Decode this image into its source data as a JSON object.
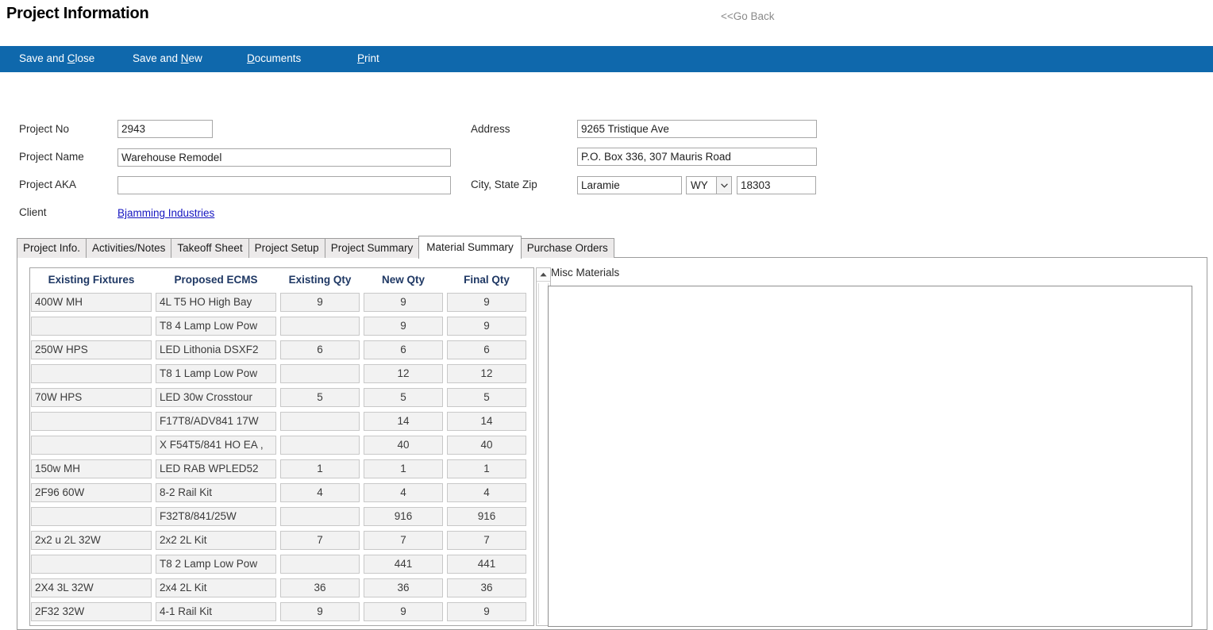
{
  "header": {
    "title": "Project Information",
    "go_back": "<<Go Back"
  },
  "command_bar": {
    "accent_color": "#0f68ac",
    "items": [
      {
        "label": "Save and Close",
        "accel_index": 9
      },
      {
        "label": "Save and New",
        "accel_index": 9
      },
      {
        "label": "Documents",
        "accel_index": 0
      },
      {
        "label": "Print",
        "accel_index": 0
      }
    ]
  },
  "form": {
    "left": {
      "project_no_label": "Project No",
      "project_no_value": "2943",
      "project_name_label": "Project Name",
      "project_name_value": "Warehouse Remodel",
      "project_aka_label": "Project AKA",
      "project_aka_value": "",
      "client_label": "Client",
      "client_value": "Bjamming Industries"
    },
    "right": {
      "address_label": "Address",
      "address_line1": "9265 Tristique Ave",
      "address_line2": "P.O. Box 336, 307 Mauris Road",
      "city_state_zip_label": "City, State Zip",
      "city": "Laramie",
      "state": "WY",
      "zip": "18303"
    }
  },
  "tabs": {
    "items": [
      {
        "label": "Project Info.",
        "active": false
      },
      {
        "label": "Activities/Notes",
        "active": false
      },
      {
        "label": "Takeoff Sheet",
        "active": false
      },
      {
        "label": "Project Setup",
        "active": false
      },
      {
        "label": "Project Summary",
        "active": false
      },
      {
        "label": "Material Summary",
        "active": true
      },
      {
        "label": "Purchase Orders",
        "active": false
      }
    ]
  },
  "material_summary": {
    "header_color": "#1f3864",
    "columns": [
      "Existing Fixtures",
      "Proposed ECMS",
      "Existing Qty",
      "New Qty",
      "Final Qty"
    ],
    "rows": [
      {
        "existing_fixtures": "400W MH",
        "proposed_ecms": "4L T5 HO High Bay",
        "existing_qty": "9",
        "new_qty": "9",
        "final_qty": "9"
      },
      {
        "existing_fixtures": "",
        "proposed_ecms": "T8 4 Lamp Low Pow",
        "existing_qty": "",
        "new_qty": "9",
        "final_qty": "9"
      },
      {
        "existing_fixtures": "250W HPS",
        "proposed_ecms": "LED Lithonia DSXF2",
        "existing_qty": "6",
        "new_qty": "6",
        "final_qty": "6"
      },
      {
        "existing_fixtures": "",
        "proposed_ecms": "T8 1 Lamp Low Pow",
        "existing_qty": "",
        "new_qty": "12",
        "final_qty": "12"
      },
      {
        "existing_fixtures": "70W HPS",
        "proposed_ecms": "LED 30w Crosstour",
        "existing_qty": "5",
        "new_qty": "5",
        "final_qty": "5"
      },
      {
        "existing_fixtures": "",
        "proposed_ecms": "F17T8/ADV841 17W",
        "existing_qty": "",
        "new_qty": "14",
        "final_qty": "14"
      },
      {
        "existing_fixtures": "",
        "proposed_ecms": "X F54T5/841 HO EA ,",
        "existing_qty": "",
        "new_qty": "40",
        "final_qty": "40"
      },
      {
        "existing_fixtures": "150w MH",
        "proposed_ecms": "LED RAB WPLED52",
        "existing_qty": "1",
        "new_qty": "1",
        "final_qty": "1"
      },
      {
        "existing_fixtures": "2F96 60W",
        "proposed_ecms": "8-2 Rail Kit",
        "existing_qty": "4",
        "new_qty": "4",
        "final_qty": "4"
      },
      {
        "existing_fixtures": "",
        "proposed_ecms": "F32T8/841/25W",
        "existing_qty": "",
        "new_qty": "916",
        "final_qty": "916"
      },
      {
        "existing_fixtures": "2x2 u 2L 32W",
        "proposed_ecms": "2x2 2L Kit",
        "existing_qty": "7",
        "new_qty": "7",
        "final_qty": "7"
      },
      {
        "existing_fixtures": "",
        "proposed_ecms": "T8 2 Lamp Low Pow",
        "existing_qty": "",
        "new_qty": "441",
        "final_qty": "441"
      },
      {
        "existing_fixtures": "2X4 3L 32W",
        "proposed_ecms": "2x4 2L Kit",
        "existing_qty": "36",
        "new_qty": "36",
        "final_qty": "36"
      },
      {
        "existing_fixtures": "2F32 32W",
        "proposed_ecms": "4-1 Rail Kit",
        "existing_qty": "9",
        "new_qty": "9",
        "final_qty": "9"
      }
    ]
  },
  "misc_materials": {
    "label": "Misc Materials",
    "value": "",
    "placeholder": ""
  }
}
